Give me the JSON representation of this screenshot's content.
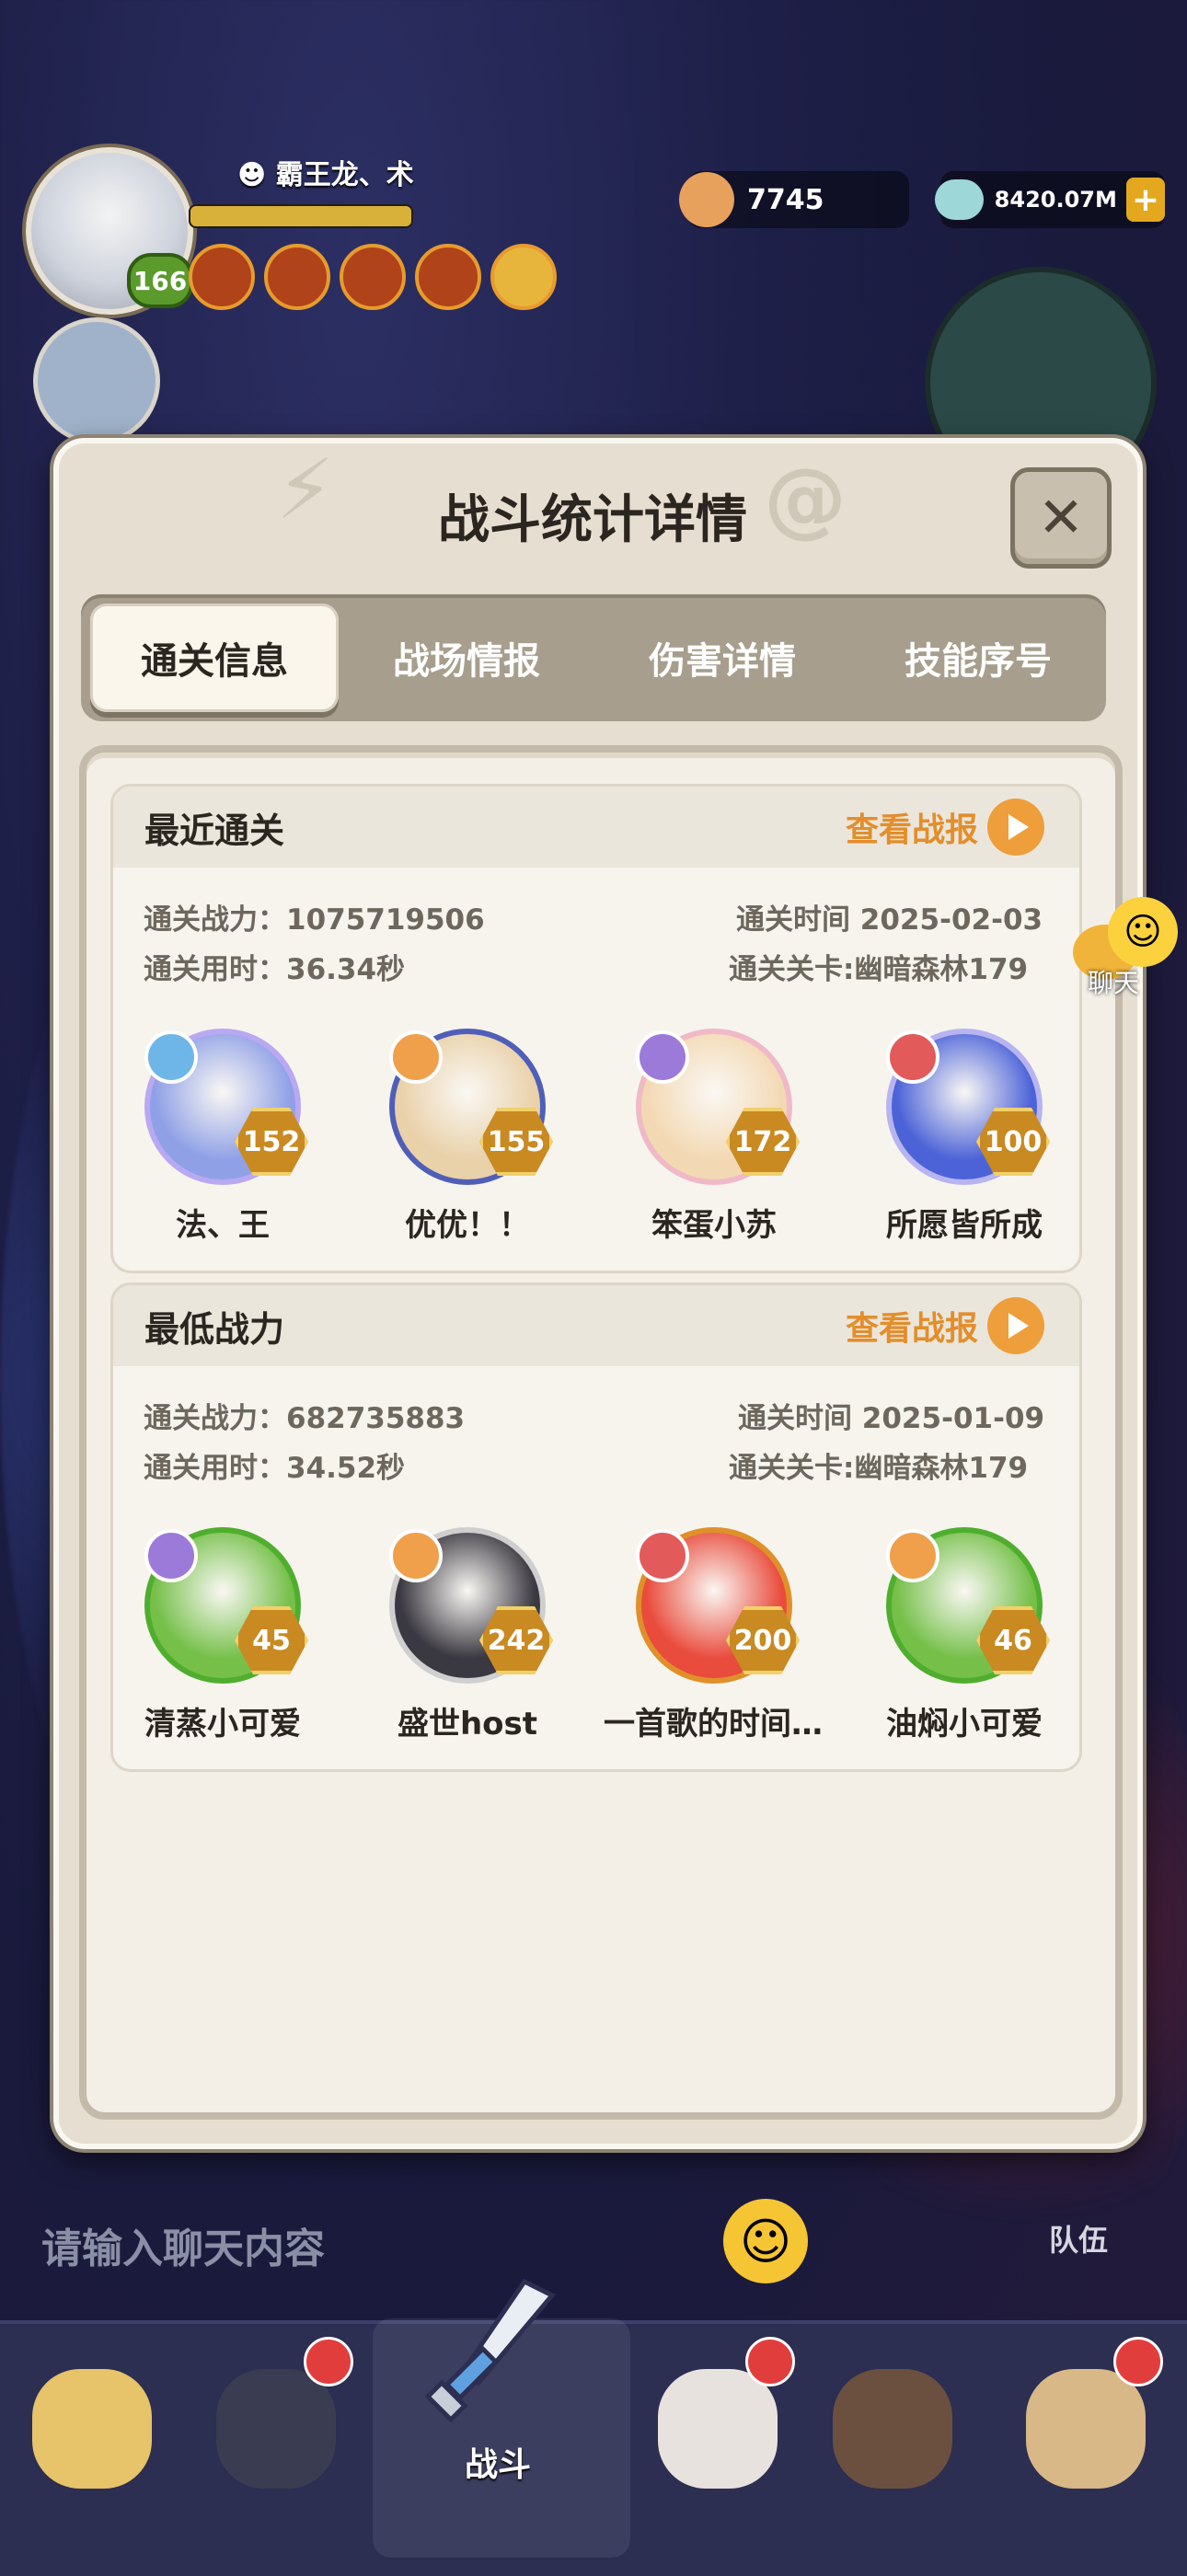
{
  "hud": {
    "player_name": "霸王龙、术",
    "player_level": "166",
    "currency_coin": "7745",
    "currency_gem": "8420.07M",
    "chat_float_label": "聊天"
  },
  "modal": {
    "title": "战斗统计详情",
    "tabs": [
      {
        "label": "通关信息",
        "active": true
      },
      {
        "label": "战场情报",
        "active": false
      },
      {
        "label": "伤害详情",
        "active": false
      },
      {
        "label": "技能序号",
        "active": false
      }
    ],
    "sections": [
      {
        "title": "最近通关",
        "view_report": "查看战报",
        "power": "通关战力：1075719506",
        "time": "通关时间  2025-02-03",
        "duration": "通关用时：36.34秒",
        "stage": "通关关卡:幽暗森林179",
        "heroes": [
          {
            "name": "法、王",
            "level": "152",
            "ring": "#b9a8f2",
            "bg": "#8fa0e6",
            "class_color": "#6fb6e8"
          },
          {
            "name": "优优！！",
            "level": "155",
            "ring": "#4f5fb8",
            "bg": "#e9d1a9",
            "class_color": "#f0a04b"
          },
          {
            "name": "笨蛋小苏",
            "level": "172",
            "ring": "#f0b9c8",
            "bg": "#f3d9b3",
            "class_color": "#9b7ad9"
          },
          {
            "name": "所愿皆所成",
            "level": "100",
            "ring": "#b7b4f1",
            "bg": "#4c63d8",
            "class_color": "#e35a5a"
          }
        ]
      },
      {
        "title": "最低战力",
        "view_report": "查看战报",
        "power": "通关战力：682735883",
        "time": "通关时间  2025-01-09",
        "duration": "通关用时：34.52秒",
        "stage": "通关关卡:幽暗森林179",
        "heroes": [
          {
            "name": "清蒸小可爱",
            "level": "45",
            "ring": "#4fae2e",
            "bg": "#76c04a",
            "class_color": "#9b7ad9"
          },
          {
            "name": "盛世host",
            "level": "242",
            "ring": "#cfcfcf",
            "bg": "#3a3840",
            "class_color": "#f0a04b"
          },
          {
            "name": "一首歌的时间...",
            "level": "200",
            "ring": "#e0902a",
            "bg": "#e94b3c",
            "class_color": "#e35a5a"
          },
          {
            "name": "油焖小可爱",
            "level": "46",
            "ring": "#4fae2e",
            "bg": "#76c04a",
            "class_color": "#f0a04b"
          }
        ]
      }
    ]
  },
  "chat": {
    "placeholder": "请输入聊天内容",
    "team_label": "队伍"
  },
  "nav": {
    "battle_label": "战斗"
  }
}
